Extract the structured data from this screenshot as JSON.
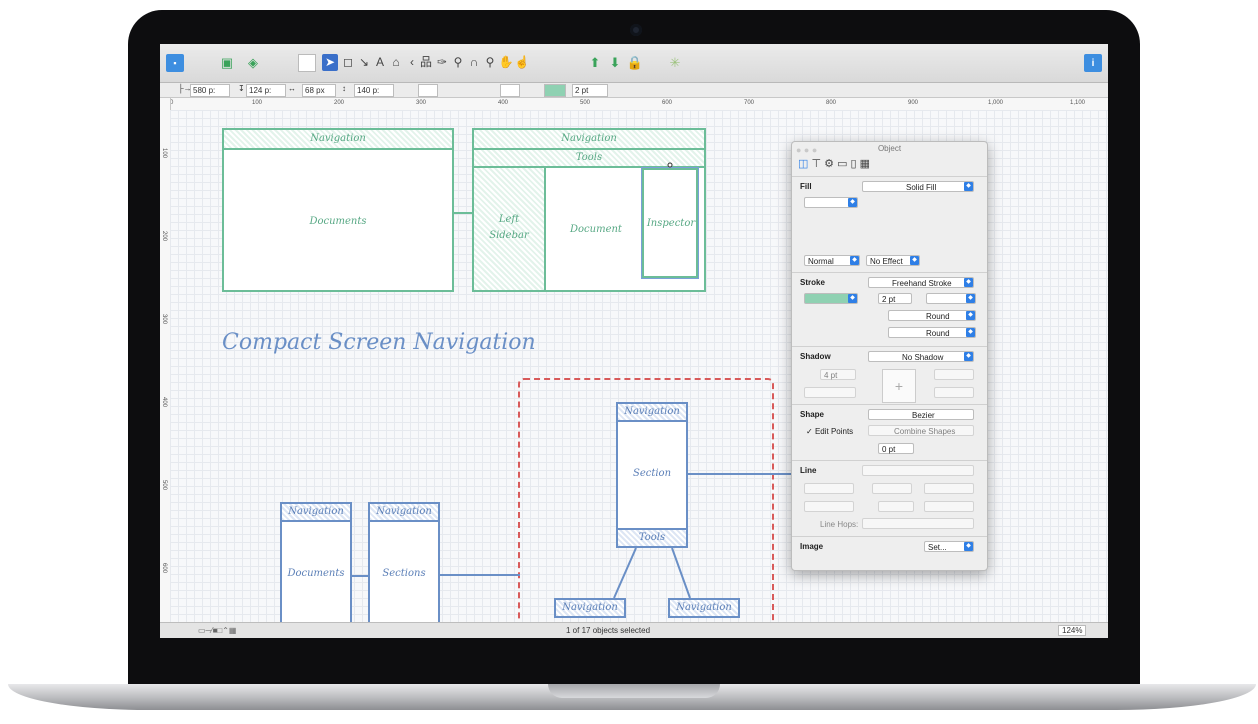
{
  "toolbar": {
    "width_value": "580 p:",
    "height_value": "124 p:",
    "x_value": "68 px",
    "y_value": "140 p:",
    "stroke_width": "2 pt"
  },
  "rulers": {
    "horizontal_ticks": [
      "0",
      "100",
      "200",
      "300",
      "400",
      "500",
      "600",
      "700",
      "800",
      "900",
      "1,000",
      "1,100"
    ],
    "vertical_ticks": [
      "100",
      "200",
      "300",
      "400",
      "500",
      "600"
    ]
  },
  "canvas": {
    "top_left": {
      "nav": "Navigation",
      "documents": "Documents"
    },
    "top_right": {
      "nav": "Navigation",
      "tools": "Tools",
      "left_sidebar_1": "Left",
      "left_sidebar_2": "Sidebar",
      "document": "Document",
      "inspector": "Inspector"
    },
    "heading": "Compact Screen Navigation",
    "bottom_center": {
      "nav": "Navigation",
      "section": "Section",
      "tools": "Tools",
      "nav_left": "Navigation",
      "nav_right": "Navigation"
    },
    "bottom_left": {
      "nav1": "Navigation",
      "documents": "Documents",
      "nav2": "Navigation",
      "sections": "Sections"
    }
  },
  "inspector": {
    "title": "Object",
    "fill": {
      "header": "Fill",
      "type": "Solid Fill",
      "blend": "Normal",
      "effect": "No Effect"
    },
    "stroke": {
      "header": "Stroke",
      "type": "Freehand Stroke",
      "width": "2 pt",
      "cap": "Round",
      "join": "Round"
    },
    "shadow": {
      "header": "Shadow",
      "type": "No Shadow",
      "size": "4 pt"
    },
    "shape": {
      "header": "Shape",
      "type": "Bezier",
      "edit_points": "Edit Points",
      "combine": "Combine Shapes",
      "corner": "0 pt"
    },
    "line": {
      "header": "Line",
      "line_hops": "Line Hops:"
    },
    "image": {
      "header": "Image",
      "set": "Set..."
    }
  },
  "status": {
    "selection": "1 of 17 objects selected",
    "zoom": "124%"
  },
  "colors": {
    "green": "#6cbd98",
    "blue": "#6a8fc6",
    "dashed": "#d85a5a",
    "accent": "#2f7fe6"
  }
}
